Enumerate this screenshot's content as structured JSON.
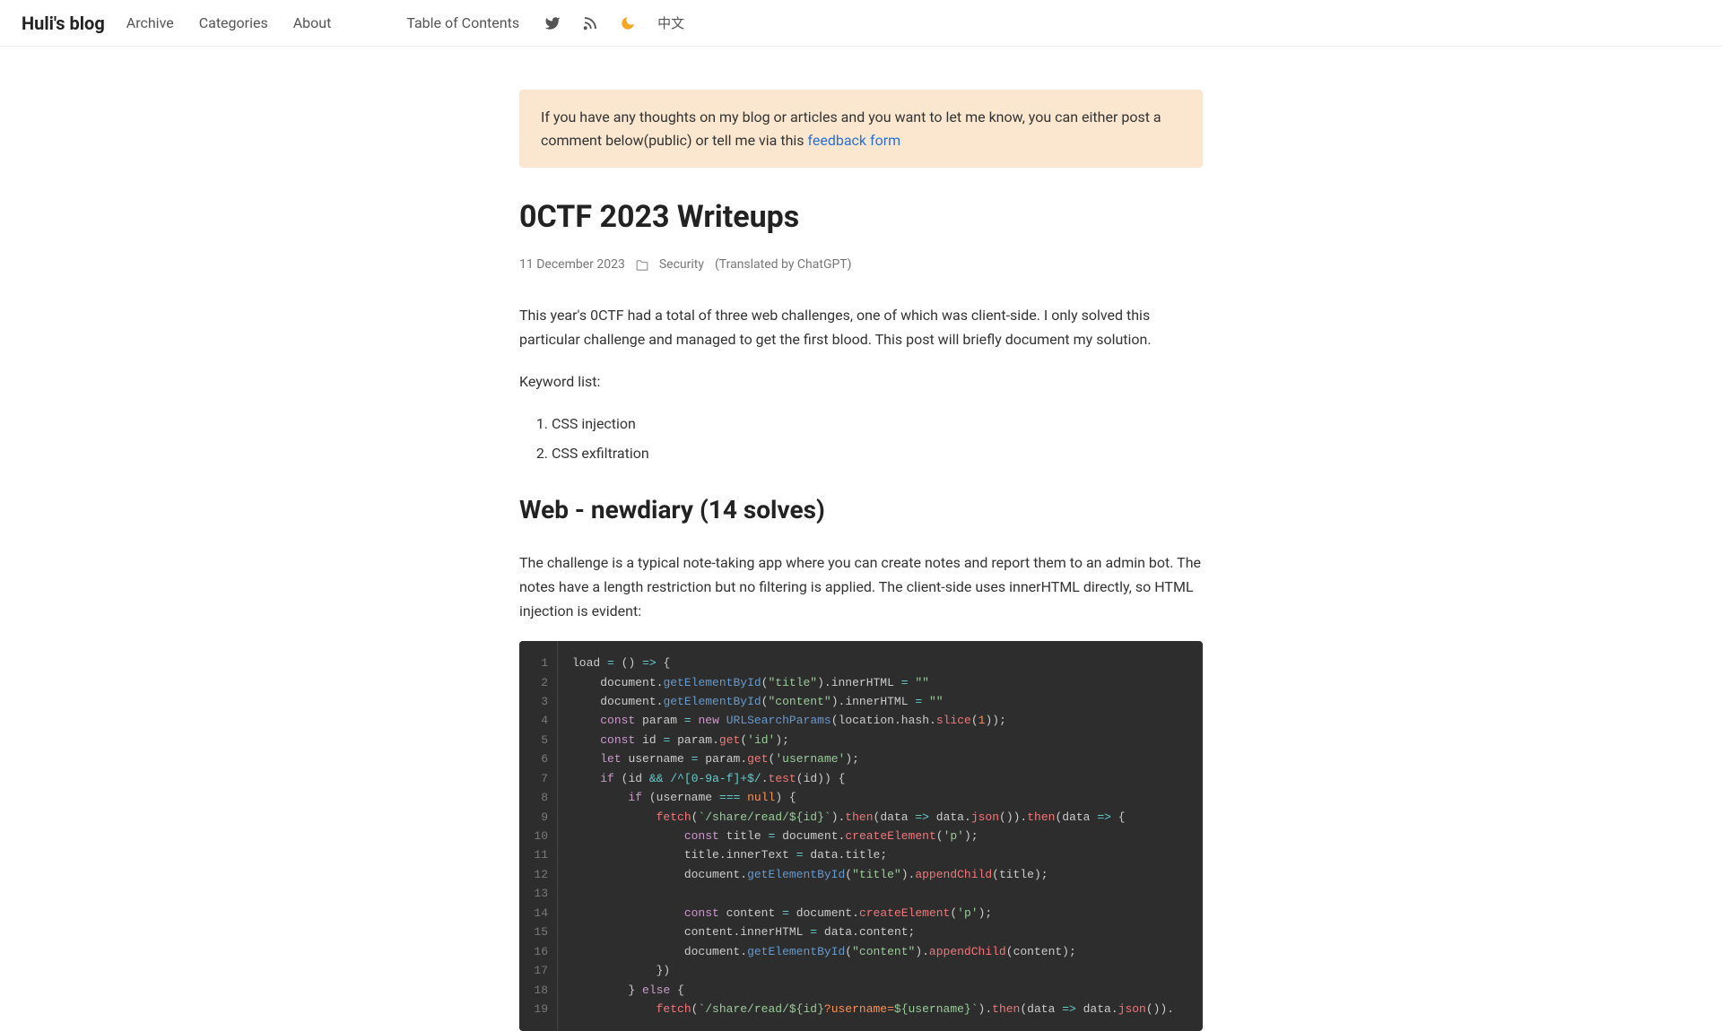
{
  "nav": {
    "brand": "Huli's blog",
    "links": [
      "Archive",
      "Categories",
      "About"
    ],
    "toc": "Table of Contents",
    "lang": "中文"
  },
  "notice": {
    "text_before": "If you have any thoughts on my blog or articles and you want to let me know, you can either post a comment below(public) or tell me via this ",
    "link_text": "feedback form"
  },
  "post": {
    "title": "0CTF 2023 Writeups",
    "date": "11 December 2023",
    "category": "Security",
    "translated": "(Translated by ChatGPT)",
    "intro": "This year's 0CTF had a total of three web challenges, one of which was client-side. I only solved this particular challenge and managed to get the first blood. This post will briefly document my solution.",
    "keyword_label": "Keyword list:",
    "keywords": [
      "CSS injection",
      "CSS exfiltration"
    ],
    "section1_title": "Web - newdiary (14 solves)",
    "section1_p1": "The challenge is a typical note-taking app where you can create notes and report them to an admin bot. The notes have a length restriction but no filtering is applied. The client-side uses innerHTML directly, so HTML injection is evident:"
  },
  "code": {
    "line_count": 19
  }
}
